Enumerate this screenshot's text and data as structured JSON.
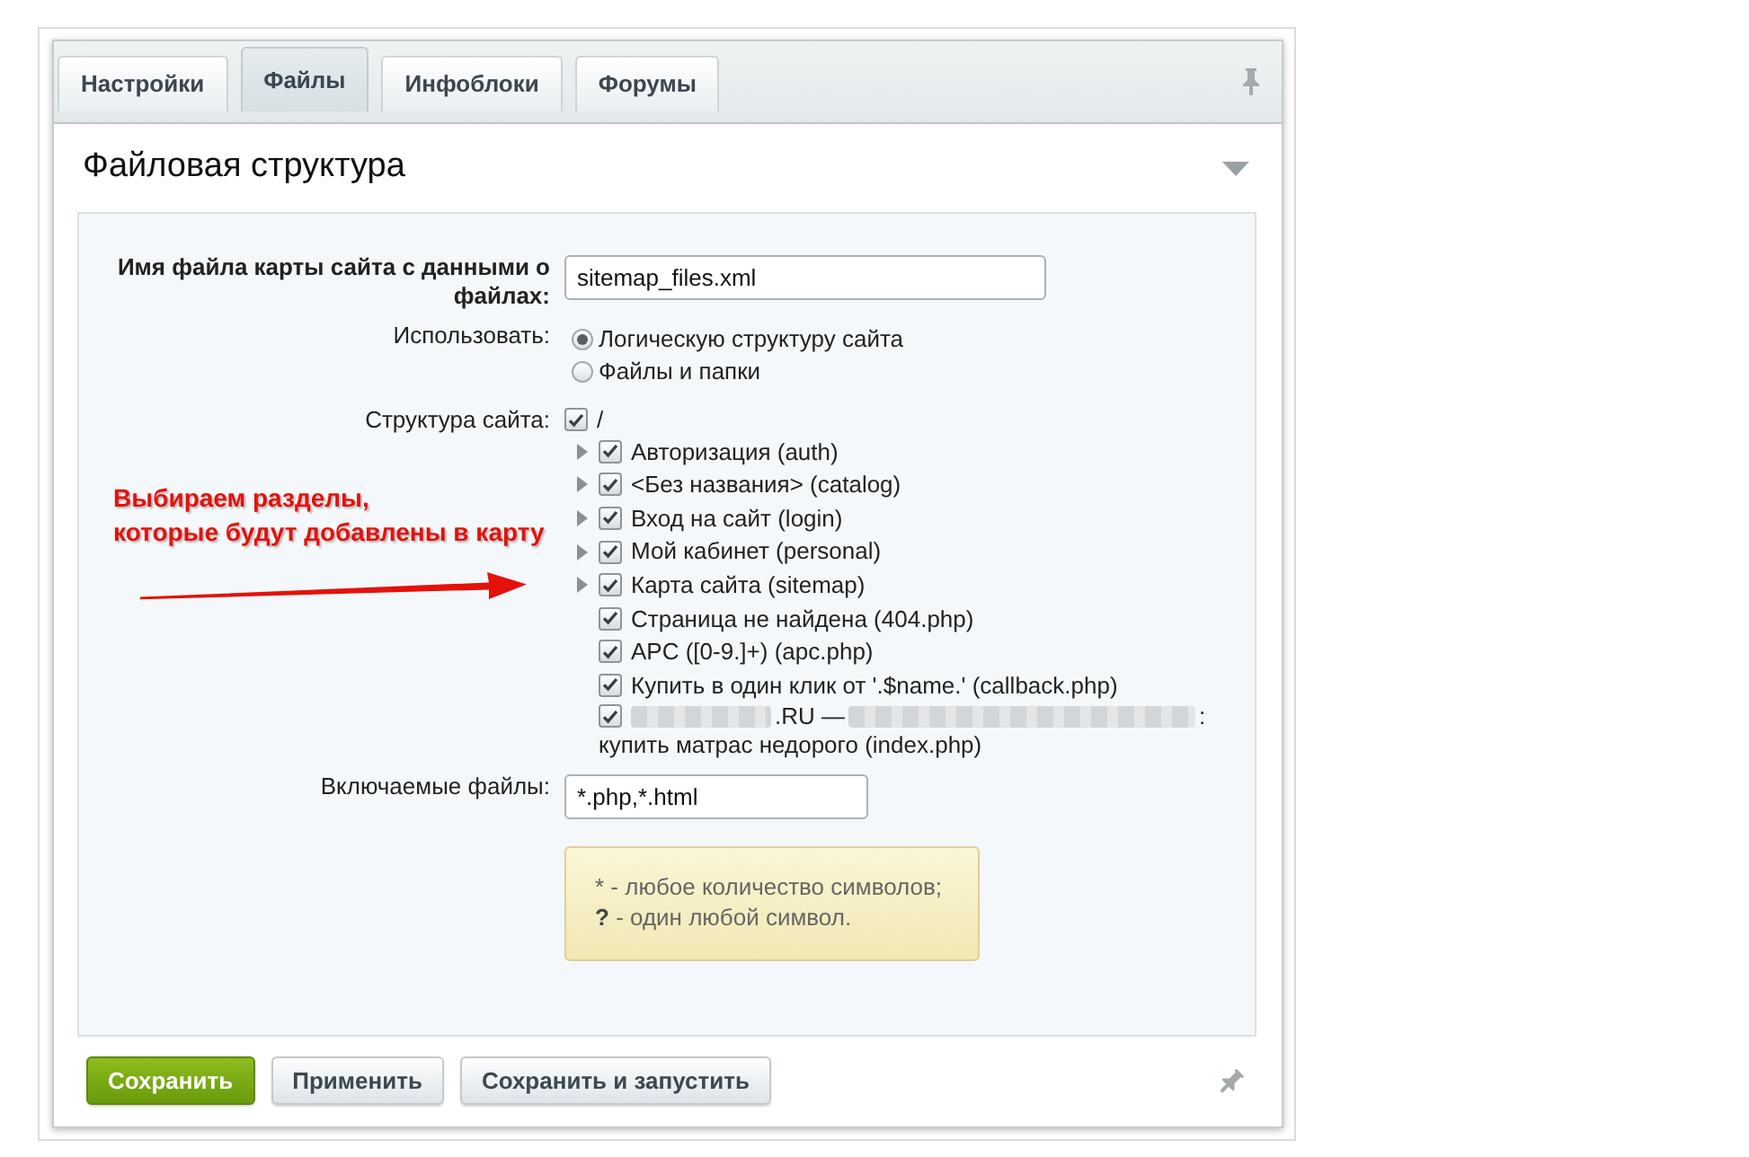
{
  "tabs": [
    {
      "label": "Настройки",
      "selected": false
    },
    {
      "label": "Файлы",
      "selected": true
    },
    {
      "label": "Инфоблоки",
      "selected": false
    },
    {
      "label": "Форумы",
      "selected": false
    }
  ],
  "section": {
    "title": "Файловая структура"
  },
  "form": {
    "sitemap_file": {
      "label": "Имя файла карты сайта с данными о файлах:",
      "value": "sitemap_files.xml"
    },
    "use": {
      "label": "Использовать:",
      "options": [
        {
          "label": "Логическую структуру сайта",
          "selected": true
        },
        {
          "label": "Файлы и папки",
          "selected": false
        }
      ]
    },
    "structure": {
      "label": "Структура сайта:",
      "root": {
        "label": "/",
        "checked": true,
        "children": [
          {
            "kind": "folder",
            "label": "Авторизация (auth)",
            "checked": true
          },
          {
            "kind": "folder",
            "label": "<Без названия> (catalog)",
            "checked": true
          },
          {
            "kind": "folder",
            "label": "Вход на сайт (login)",
            "checked": true
          },
          {
            "kind": "folder",
            "label": "Мой кабинет (personal)",
            "checked": true
          },
          {
            "kind": "folder",
            "label": "Карта сайта (sitemap)",
            "checked": true
          },
          {
            "kind": "page",
            "label": "Страница не найдена (404.php)",
            "checked": true
          },
          {
            "kind": "page",
            "label": "APC ([0-9.]+) (apc.php)",
            "checked": true
          },
          {
            "kind": "page",
            "label": "Купить в один клик от '.$name.' (callback.php)",
            "checked": true
          },
          {
            "kind": "page",
            "checked": true,
            "label_lines": [
              [
                {
                  "kind": "blur"
                },
                {
                  "kind": "text",
                  "text": ".RU —"
                },
                {
                  "kind": "blur"
                },
                {
                  "kind": "text",
                  "text": ":"
                }
              ],
              [
                {
                  "kind": "text",
                  "text": "купить матрас недорого (index.php)"
                }
              ]
            ]
          }
        ]
      }
    },
    "included_files": {
      "label": "Включаемые файлы:",
      "value": "*.php,*.html"
    },
    "hint": {
      "lines": [
        "* - любое количество символов;",
        "**?** - один любой символ."
      ]
    }
  },
  "annotation": {
    "lines": [
      "Выбираем разделы,",
      "которые будут добавлены в карту"
    ]
  },
  "buttons": [
    {
      "label": "Сохранить",
      "kind": "primary"
    },
    {
      "label": "Применить",
      "kind": "secondary"
    },
    {
      "label": "Сохранить и запустить",
      "kind": "secondary"
    }
  ]
}
